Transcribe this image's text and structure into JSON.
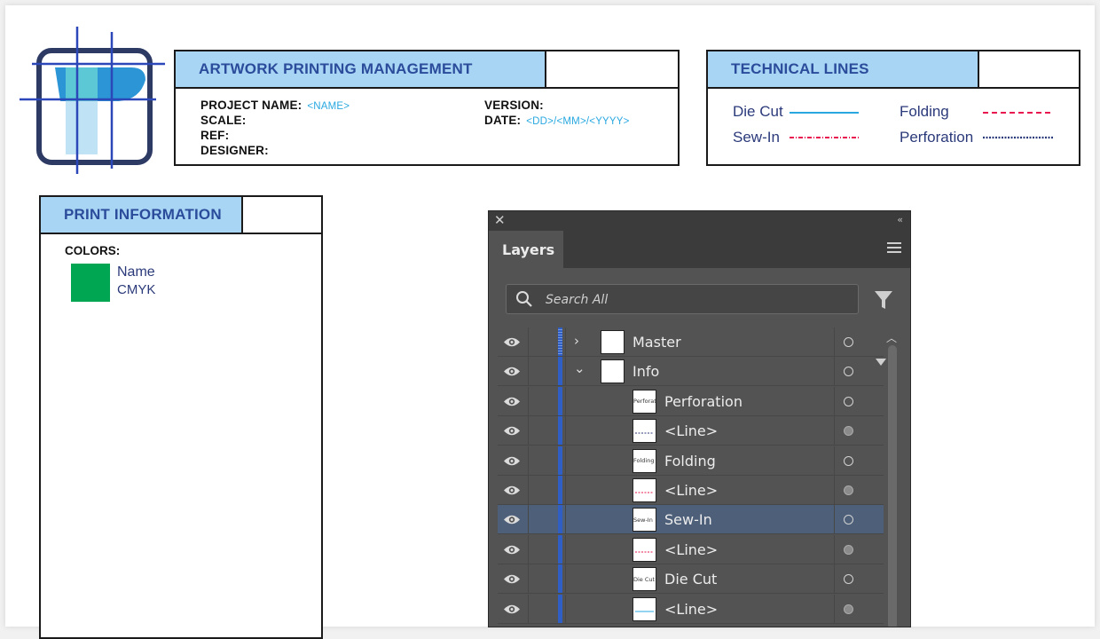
{
  "project_box": {
    "title": "ARTWORK PRINTING MANAGEMENT",
    "project_name_label": "PROJECT NAME:",
    "project_name_value": "<NAME>",
    "scale_label": "SCALE:",
    "ref_label": "REF:",
    "designer_label": "DESIGNER:",
    "version_label": "VERSION:",
    "date_label": "DATE:",
    "date_value": "<DD>/<MM>/<YYYY>"
  },
  "technical_lines": {
    "title": "TECHNICAL LINES",
    "items": [
      {
        "label": "Die Cut",
        "color": "#29a8e0",
        "style": "solid"
      },
      {
        "label": "Sew-In",
        "color": "#e8174f",
        "style": "dash-dot"
      },
      {
        "label": "Folding",
        "color": "#e8174f",
        "style": "dashed"
      },
      {
        "label": "Perforation",
        "color": "#2b3a7a",
        "style": "dotted"
      }
    ]
  },
  "print_info": {
    "title": "PRINT INFORMATION",
    "colors_label": "COLORS:",
    "swatch": {
      "name": "Name",
      "mode": "CMYK",
      "color": "#00a651"
    }
  },
  "layers_panel": {
    "tab": "Layers",
    "search_placeholder": "Search All",
    "rows": [
      {
        "name": "Master",
        "expand": "collapsed",
        "thumb": "",
        "target": "empty",
        "selected": false
      },
      {
        "name": "Info",
        "expand": "expanded",
        "thumb": "",
        "target": "empty",
        "selected": false
      },
      {
        "name": "Perforation",
        "expand": "none",
        "thumb": "Perforation",
        "target": "empty",
        "selected": false
      },
      {
        "name": "<Line>",
        "expand": "none",
        "thumb": "",
        "target": "filled",
        "selected": false
      },
      {
        "name": "Folding",
        "expand": "none",
        "thumb": "Folding",
        "target": "empty",
        "selected": false
      },
      {
        "name": "<Line>",
        "expand": "none",
        "thumb": "",
        "target": "filled",
        "selected": false
      },
      {
        "name": "Sew-In",
        "expand": "none",
        "thumb": "Sew-In",
        "target": "empty",
        "selected": true
      },
      {
        "name": "<Line>",
        "expand": "none",
        "thumb": "",
        "target": "filled",
        "selected": false
      },
      {
        "name": "Die Cut",
        "expand": "none",
        "thumb": "Die Cut",
        "target": "empty",
        "selected": false
      },
      {
        "name": "<Line>",
        "expand": "none",
        "thumb": "",
        "target": "filled",
        "selected": false
      }
    ]
  }
}
